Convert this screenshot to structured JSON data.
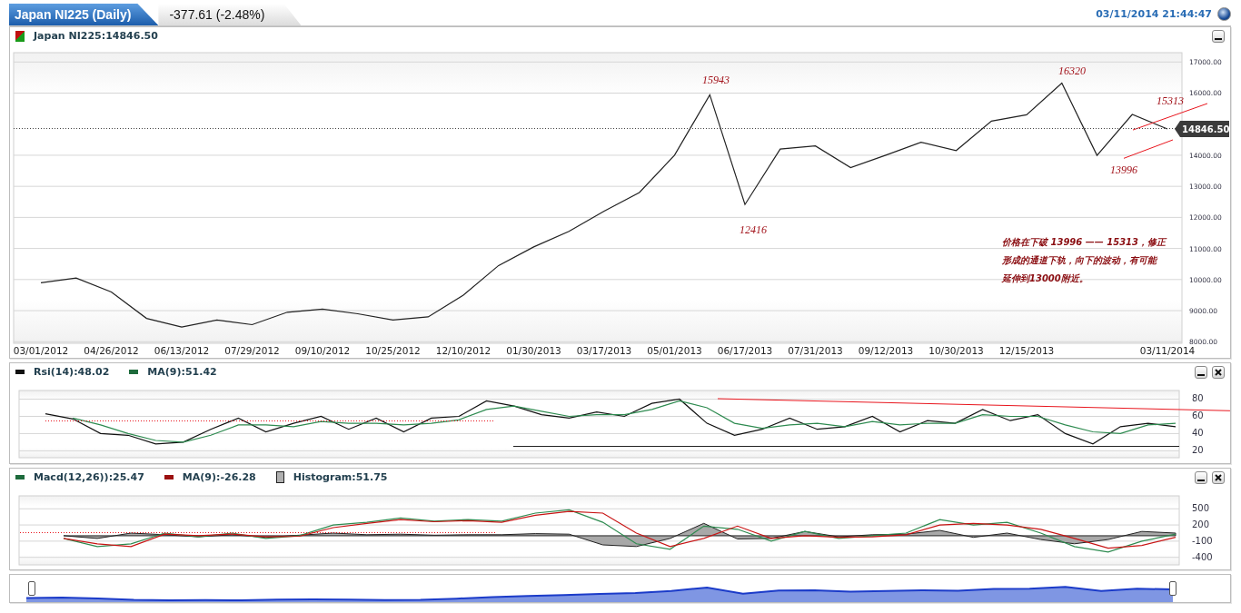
{
  "header": {
    "title_tab": "Japan NI225 (Daily)",
    "change": "-377.61 (-2.48%)",
    "timestamp": "03/11/2014 21:44:47"
  },
  "main_chart": {
    "legend": "Japan NI225:14846.50",
    "price_tag": "14846.50",
    "note": [
      "价格在下破 13996 —— 15313，修正",
      "形成的通道下轨，向下的波动，有可能",
      "延伸到13000附近。"
    ],
    "chart_data": {
      "type": "line",
      "categories": [
        "03/01/2012",
        null,
        "04/26/2012",
        null,
        "06/13/2012",
        null,
        "07/29/2012",
        null,
        "09/10/2012",
        null,
        "10/25/2012",
        null,
        "12/10/2012",
        null,
        "01/30/2013",
        null,
        "03/17/2013",
        null,
        "05/01/2013",
        null,
        "06/17/2013",
        null,
        "07/31/2013",
        null,
        "09/12/2013",
        null,
        "10/30/2013",
        null,
        "12/15/2013",
        null,
        null,
        null,
        "03/11/2014"
      ],
      "grid": true,
      "series": [
        {
          "color": "#222222",
          "values": [
            9900,
            10050,
            9600,
            8750,
            8470,
            8700,
            8550,
            8950,
            9050,
            8900,
            8700,
            8800,
            9500,
            10450,
            11050,
            11550,
            12200,
            12800,
            14000,
            15943,
            12416,
            14200,
            14300,
            13600,
            14000,
            14420,
            14150,
            15100,
            15300,
            16320,
            13996,
            15313,
            14846
          ]
        }
      ],
      "ylim": [
        7950,
        17300
      ],
      "yticks": [
        {
          "value": 8000,
          "label": "8000.00"
        },
        {
          "value": 9000,
          "label": "9000.00"
        },
        {
          "value": 10000,
          "label": "10000.00"
        },
        {
          "value": 11000,
          "label": "11000.00"
        },
        {
          "value": 12000,
          "label": "12000.00"
        },
        {
          "value": 13000,
          "label": "13000.00"
        },
        {
          "value": 14000,
          "label": "14000.00"
        },
        {
          "value": 16000,
          "label": "16000.00"
        },
        {
          "value": 17000,
          "label": "17000.00"
        }
      ],
      "annotations": [
        "15943",
        "12416",
        "16320",
        "15313",
        "13996"
      ]
    }
  },
  "rsi_panel": {
    "legend": [
      {
        "label": "Rsi(14):48.02",
        "color": "#111111"
      },
      {
        "label": "MA(9):51.42",
        "color": "#1e6b3c"
      }
    ],
    "chart_data": {
      "type": "line",
      "grid": true,
      "series": [
        {
          "color": "#111111",
          "values": [
            63,
            57,
            40,
            38,
            28,
            30,
            45,
            58,
            42,
            52,
            60,
            45,
            58,
            42,
            58,
            60,
            78,
            72,
            62,
            58,
            65,
            60,
            75,
            80,
            52,
            38,
            45,
            58,
            45,
            48,
            60,
            42,
            55,
            52,
            68,
            55,
            62,
            40,
            28,
            48,
            52,
            48
          ]
        },
        {
          "color": "#2e8b50",
          "values": [
            null,
            58,
            50,
            40,
            32,
            30,
            38,
            50,
            50,
            48,
            54,
            52,
            52,
            50,
            52,
            56,
            68,
            72,
            66,
            60,
            62,
            62,
            68,
            78,
            70,
            52,
            46,
            50,
            52,
            48,
            54,
            50,
            52,
            52,
            62,
            60,
            60,
            50,
            42,
            40,
            50,
            52
          ]
        }
      ],
      "ylim": [
        12,
        90
      ],
      "yticks": [
        20,
        40,
        60,
        80
      ]
    }
  },
  "macd_panel": {
    "legend": [
      {
        "label": "Macd(12,26)):25.47",
        "color": "#1e6b3c",
        "kind": "line"
      },
      {
        "label": "MA(9):-26.28",
        "color": "#9b1010",
        "kind": "line"
      },
      {
        "label": "Histogram:51.75",
        "color": "#b0b0b0",
        "kind": "histogram"
      }
    ],
    "chart_data": {
      "type": "line",
      "grid": true,
      "series": [
        {
          "color": "#2e8b50",
          "values": [
            -50,
            -200,
            -150,
            50,
            -20,
            50,
            -50,
            0,
            200,
            250,
            330,
            270,
            300,
            270,
            420,
            480,
            250,
            -150,
            -250,
            180,
            120,
            -100,
            80,
            -50,
            0,
            50,
            300,
            200,
            250,
            50,
            -200,
            -300,
            -100,
            30
          ]
        },
        {
          "color": "#c81414",
          "values": [
            -50,
            -150,
            -200,
            30,
            0,
            30,
            -20,
            -10,
            150,
            230,
            300,
            260,
            280,
            250,
            380,
            450,
            420,
            50,
            -200,
            -50,
            180,
            -50,
            0,
            -30,
            -20,
            20,
            200,
            230,
            200,
            120,
            -50,
            -230,
            -180,
            -30
          ]
        },
        {
          "type": "area",
          "color": "#a8a8a8",
          "values": [
            0,
            -50,
            50,
            20,
            -20,
            20,
            -30,
            10,
            50,
            20,
            30,
            10,
            20,
            20,
            40,
            30,
            -170,
            -200,
            -50,
            230,
            -60,
            -50,
            80,
            -20,
            20,
            30,
            100,
            -30,
            50,
            -70,
            -150,
            -70,
            80,
            50
          ]
        }
      ],
      "ylim": [
        -540,
        740
      ],
      "yticks": [
        500,
        200,
        -100,
        -400
      ]
    }
  }
}
